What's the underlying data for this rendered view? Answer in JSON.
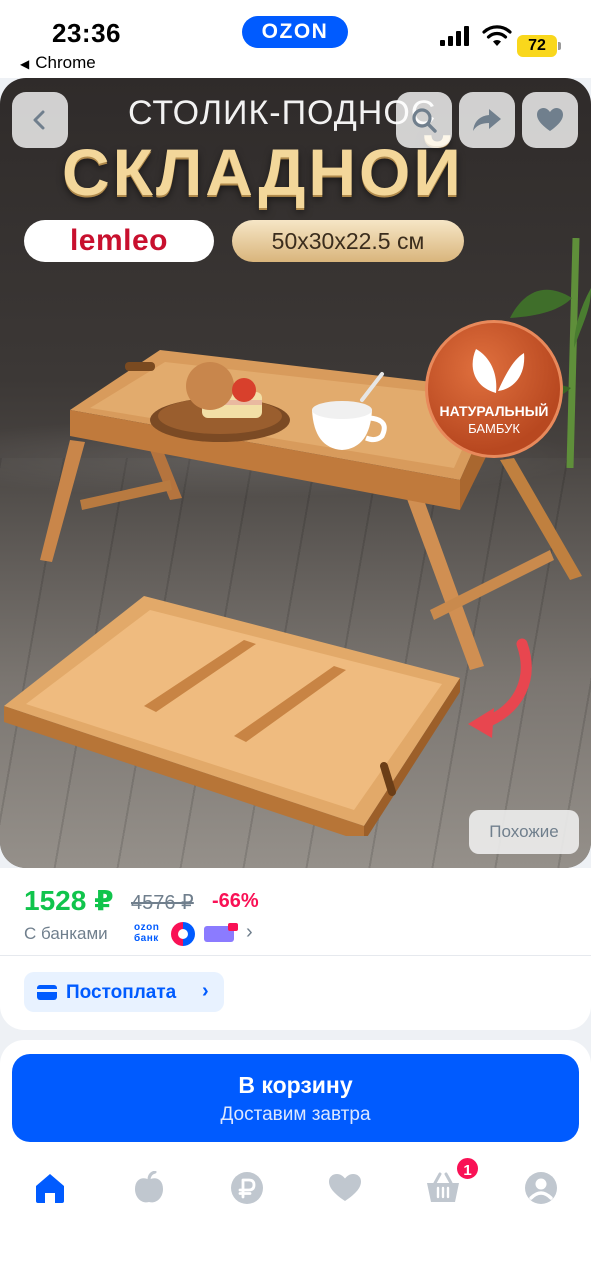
{
  "status_bar": {
    "time": "23:36",
    "back_app_label": "Chrome",
    "app_pill": "OZON",
    "battery": "72"
  },
  "hero": {
    "title_top": "СТОЛИК-ПОДНОС",
    "title_main": "СКЛАДНОЙ",
    "brand": "lemleo",
    "size": "50x30x22.5 см",
    "badge_line1": "НАТУРАЛЬНЫЙ",
    "badge_line2": "БАМБУК",
    "similar_label": "Похожие",
    "icons": [
      "back-icon",
      "search-icon",
      "share-icon",
      "heart-icon"
    ]
  },
  "price": {
    "current": "1528 ₽",
    "old": "4576 ₽",
    "discount": "-66%",
    "bank_label": "С банками",
    "ozon_bank_line1": "ozon",
    "ozon_bank_line2": "банк"
  },
  "postpay": {
    "label": "Постоплата"
  },
  "cart": {
    "label": "В корзину",
    "sublabel": "Доставим завтра"
  },
  "tabbar": {
    "items": [
      {
        "name": "home",
        "icon": "home-icon",
        "active": true
      },
      {
        "name": "fresh",
        "icon": "apple-icon",
        "active": false
      },
      {
        "name": "finance",
        "icon": "ruble-icon",
        "active": false
      },
      {
        "name": "favorites",
        "icon": "heart-icon",
        "active": false
      },
      {
        "name": "cart",
        "icon": "basket-icon",
        "active": false
      },
      {
        "name": "profile",
        "icon": "profile-icon",
        "active": false
      }
    ],
    "cart_badge": "1"
  },
  "colors": {
    "accent": "#005bff",
    "price_green": "#10c44c",
    "discount_pink": "#f91155",
    "muted": "#707f8d"
  }
}
